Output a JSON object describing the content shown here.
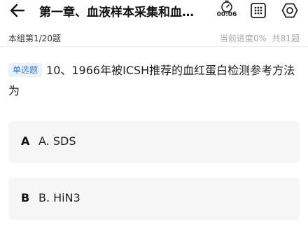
{
  "header": {
    "title": "第一章、血液样本采集和血…",
    "timer": "00:06",
    "icons": [
      "back-arrow-icon",
      "stopwatch-icon",
      "answer-grid-icon",
      "settings-icon"
    ]
  },
  "subheader": {
    "group_label": "本组第1/20题",
    "progress_text": "当前进度0%",
    "total_text": "共81题"
  },
  "question": {
    "type_badge": "单选题",
    "text": "10、1966年被ICSH推荐的血红蛋白检测参考方法为"
  },
  "options": [
    {
      "letter": "A",
      "text": "A. SDS"
    },
    {
      "letter": "B",
      "text": "B. HiN3"
    }
  ],
  "colors": {
    "badge_bg": "#eaf2ff",
    "badge_text": "#3a7bd5",
    "option_bg": "#f6f6f6",
    "muted_text": "#aaaaaa"
  }
}
